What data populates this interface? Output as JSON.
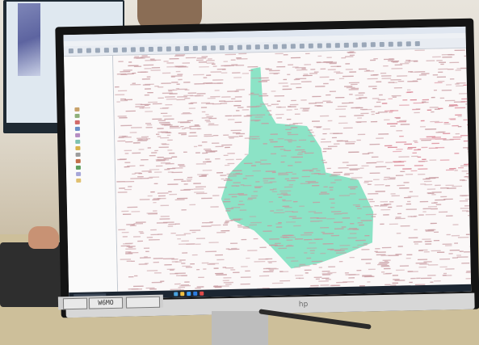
{
  "photo": {
    "subject": "hp-monitor-gis-map",
    "monitor": {
      "brand_logo": "hp",
      "app": {
        "layer_swatches": [
          "#c8a26a",
          "#8fb07a",
          "#d16a6a",
          "#6a8fc8",
          "#b58cc2",
          "#7fc2b0",
          "#d8b24a",
          "#9c9c9c",
          "#c26f4a",
          "#5e9e5e",
          "#a6a6d8",
          "#e0c070"
        ],
        "map": {
          "highlight_color": "#7fe0c0",
          "label_color": "#c79aa0",
          "dense_cluster_color": "#d77f8f"
        },
        "taskbar_icons": [
          "#4aa3df",
          "#f0c040",
          "#3aa0ff",
          "#2d7de0",
          "#e04a4a"
        ]
      }
    },
    "stickers": [
      {
        "text": ""
      },
      {
        "text": "W6MO"
      },
      {
        "text": ""
      }
    ]
  }
}
